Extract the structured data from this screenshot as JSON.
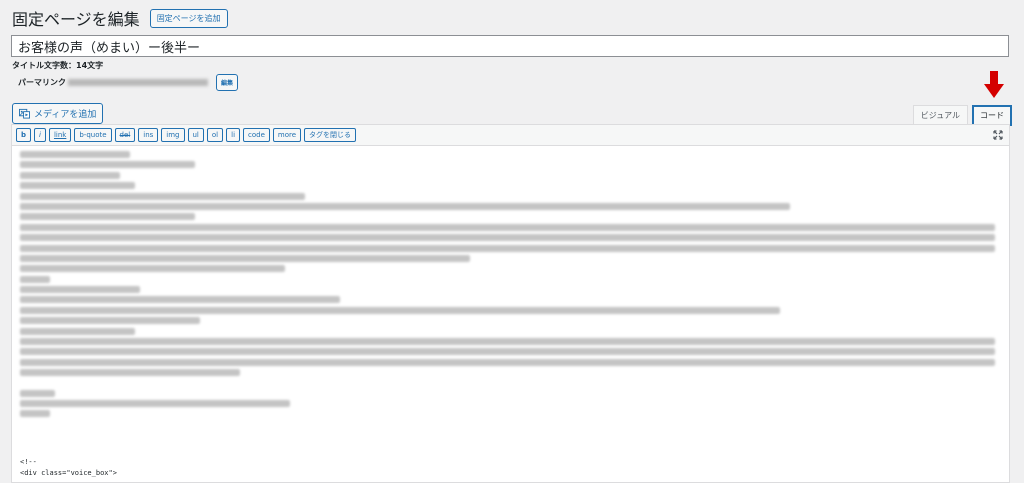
{
  "header": {
    "title": "固定ページを編集",
    "add_new_label": "固定ページを追加"
  },
  "post": {
    "title": "お客様の声（めまい）ー後半ー",
    "title_count": "タイトル文字数：14文字",
    "permalink_label": "パーマリンク",
    "edit_label": "編集"
  },
  "media": {
    "add_label": "メディアを追加"
  },
  "tabs": {
    "visual": "ビジュアル",
    "code": "コード"
  },
  "toolbar": {
    "buttons": [
      "b",
      "i",
      "link",
      "b-quote",
      "del",
      "ins",
      "img",
      "ul",
      "ol",
      "li",
      "code",
      "more",
      "タグを閉じる"
    ]
  },
  "editor": {
    "visible_code": [
      "<!--",
      "<div class=\"voice_box\">"
    ]
  },
  "colors": {
    "accent": "#2271b1",
    "arrow": "#d40000"
  }
}
